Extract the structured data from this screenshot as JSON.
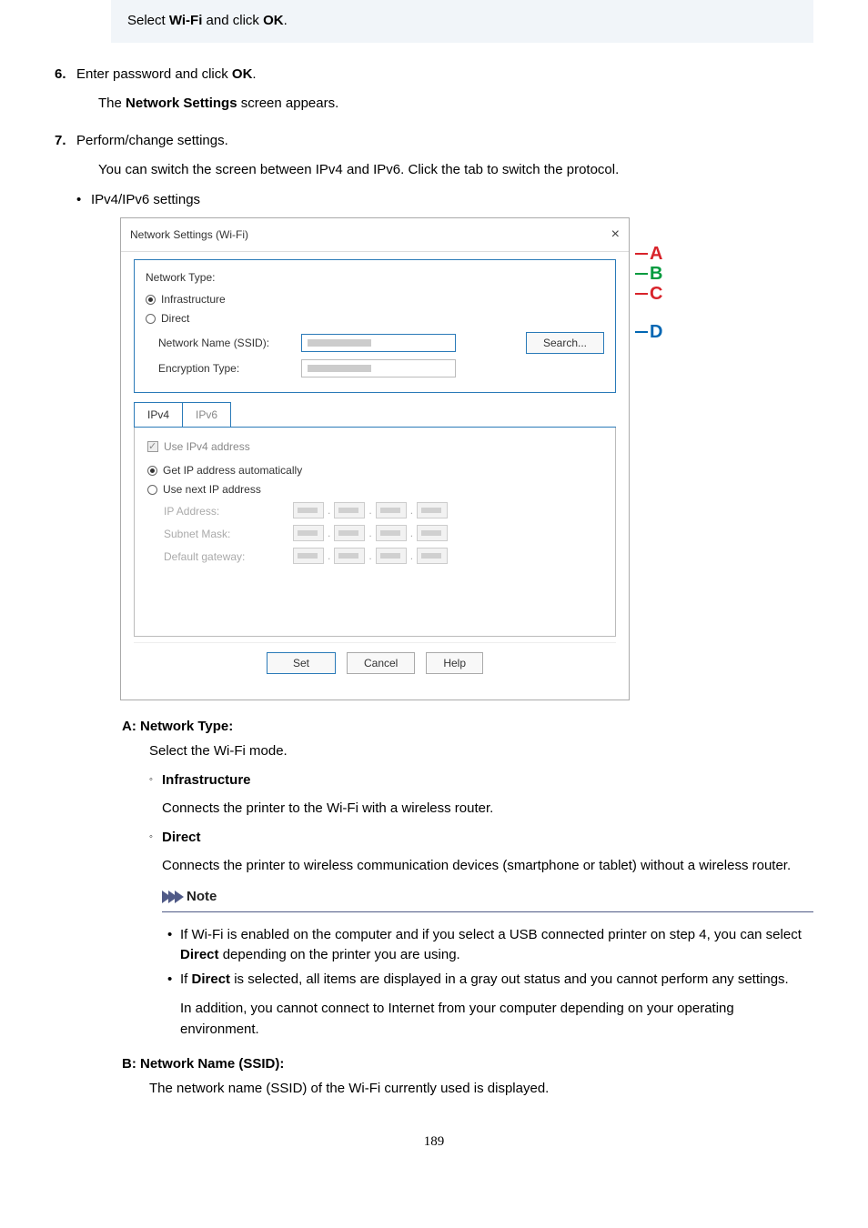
{
  "info_box": "Select <b>Wi-Fi</b> and click <b>OK</b>.",
  "step6": {
    "num": "6.",
    "title": "Enter password and click <b>OK</b>.",
    "body": "The <b>Network Settings</b> screen appears."
  },
  "step7": {
    "num": "7.",
    "title": "Perform/change settings.",
    "intro": "You can switch the screen between IPv4 and IPv6. Click the tab to switch the protocol.",
    "bullet_label": "IPv4/IPv6 settings"
  },
  "dialog": {
    "title": "Network Settings (Wi-Fi)",
    "fieldset_label": "Network Type:",
    "radio_infra": "Infrastructure",
    "radio_direct": "Direct",
    "ssid_label": "Network Name (SSID):",
    "enc_label": "Encryption Type:",
    "search_btn": "Search...",
    "tab_ipv4": "IPv4",
    "tab_ipv6": "IPv6",
    "chk_use_ipv4": "Use IPv4 address",
    "radio_auto": "Get IP address automatically",
    "radio_next": "Use next IP address",
    "ip_label": "IP Address:",
    "subnet_label": "Subnet Mask:",
    "gw_label": "Default gateway:",
    "btn_set": "Set",
    "btn_cancel": "Cancel",
    "btn_help": "Help"
  },
  "markers": {
    "A": "A",
    "B": "B",
    "C": "C",
    "D": "D"
  },
  "descA": {
    "title": "A: Network Type:",
    "intro": "Select the Wi-Fi mode.",
    "infra_label": "Infrastructure",
    "infra_text": "Connects the printer to the Wi-Fi with a wireless router.",
    "direct_label": "Direct",
    "direct_text": "Connects the printer to wireless communication devices (smartphone or tablet) without a wireless router.",
    "note_header": "Note",
    "note1": "If Wi-Fi is enabled on the computer and if you select a USB connected printer on step 4, you can select <b>Direct</b> depending on the printer you are using.",
    "note2": "If <b>Direct</b> is selected, all items are displayed in a gray out status and you cannot perform any settings.",
    "note2b": "In addition, you cannot connect to Internet from your computer depending on your operating environment."
  },
  "descB": {
    "title": "B: Network Name (SSID):",
    "text": "The network name (SSID) of the Wi-Fi currently used is displayed."
  },
  "page_number": "189"
}
